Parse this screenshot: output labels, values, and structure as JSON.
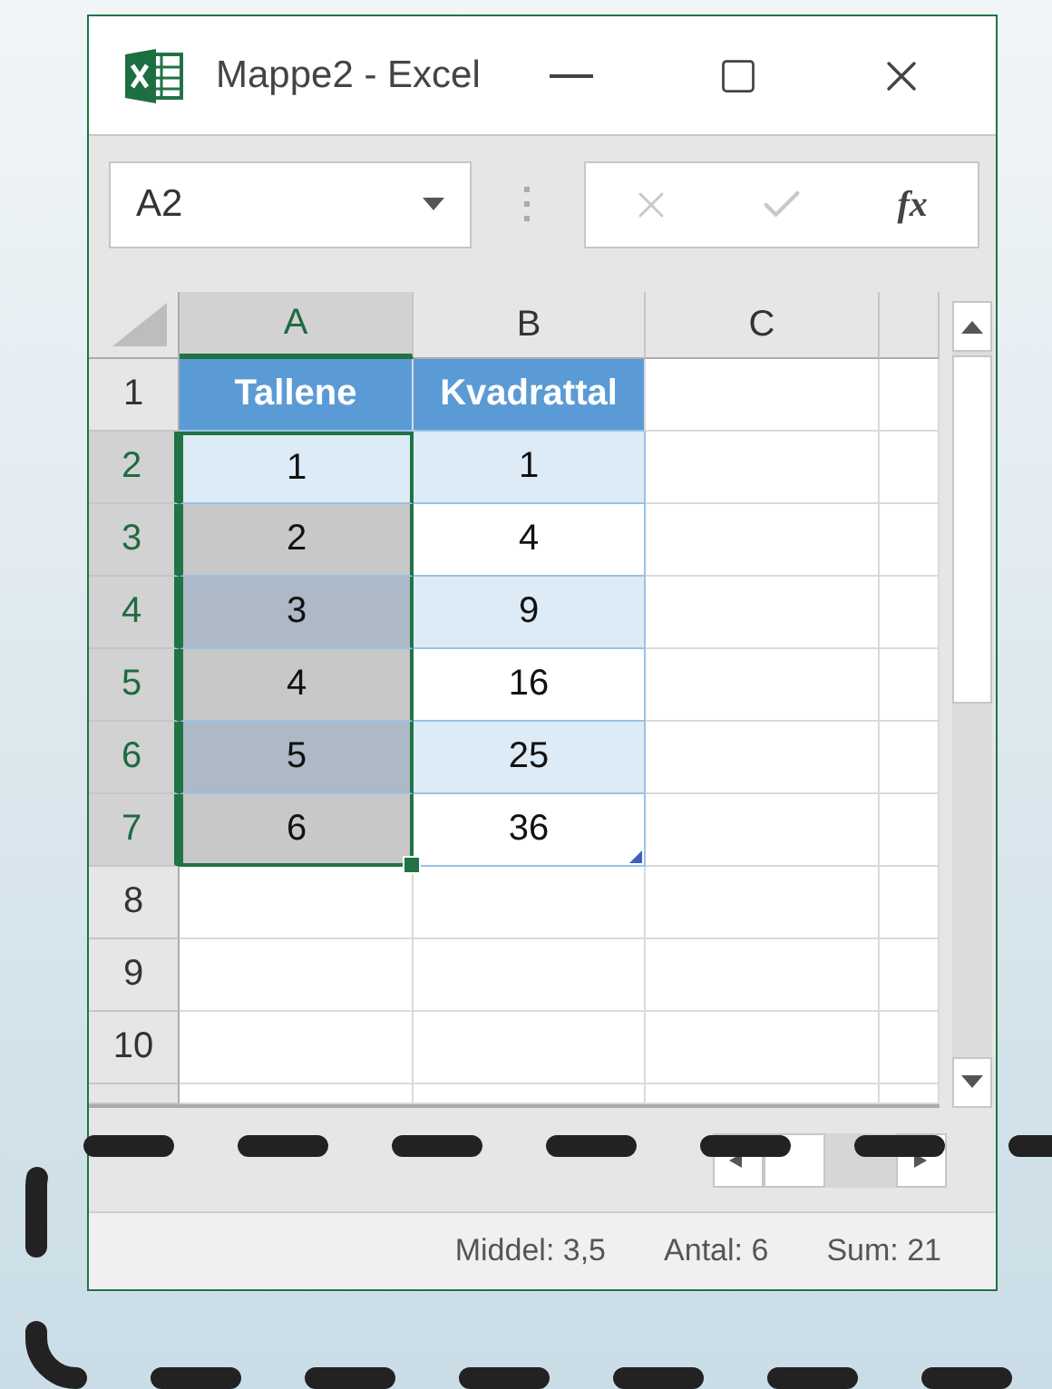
{
  "window": {
    "title": "Mappe2 - Excel"
  },
  "formula_bar": {
    "name_box": "A2",
    "function_button": "fx"
  },
  "sheet": {
    "columns": [
      {
        "label": "A",
        "selected": true
      },
      {
        "label": "B",
        "selected": false
      },
      {
        "label": "C",
        "selected": false
      }
    ],
    "rows": [
      {
        "header": "1",
        "selected": false,
        "cells": [
          {
            "value": "Tallene",
            "kind": "table-header",
            "selected": false
          },
          {
            "value": "Kvadrattal",
            "kind": "table-header",
            "selected": false
          }
        ]
      },
      {
        "header": "2",
        "selected": true,
        "cells": [
          {
            "value": "1",
            "kind": "table",
            "banded": true,
            "selected": true,
            "active": true
          },
          {
            "value": "1",
            "kind": "table",
            "banded": true,
            "selected": false
          }
        ]
      },
      {
        "header": "3",
        "selected": true,
        "cells": [
          {
            "value": "2",
            "kind": "table",
            "banded": false,
            "selected": true,
            "active": false
          },
          {
            "value": "4",
            "kind": "table",
            "banded": false,
            "selected": false
          }
        ]
      },
      {
        "header": "4",
        "selected": true,
        "cells": [
          {
            "value": "3",
            "kind": "table",
            "banded": true,
            "selected": true,
            "active": false
          },
          {
            "value": "9",
            "kind": "table",
            "banded": true,
            "selected": false
          }
        ]
      },
      {
        "header": "5",
        "selected": true,
        "cells": [
          {
            "value": "4",
            "kind": "table",
            "banded": false,
            "selected": true,
            "active": false
          },
          {
            "value": "16",
            "kind": "table",
            "banded": false,
            "selected": false
          }
        ]
      },
      {
        "header": "6",
        "selected": true,
        "cells": [
          {
            "value": "5",
            "kind": "table",
            "banded": true,
            "selected": true,
            "active": false
          },
          {
            "value": "25",
            "kind": "table",
            "banded": true,
            "selected": false
          }
        ]
      },
      {
        "header": "7",
        "selected": true,
        "cells": [
          {
            "value": "6",
            "kind": "table",
            "banded": false,
            "selected": true,
            "active": false
          },
          {
            "value": "36",
            "kind": "table",
            "banded": false,
            "selected": false
          }
        ]
      },
      {
        "header": "8",
        "selected": false
      },
      {
        "header": "9",
        "selected": false
      },
      {
        "header": "10",
        "selected": false
      }
    ]
  },
  "status_bar": [
    "Middel: 3,5",
    "Antal: 6",
    "Sum: 21"
  ]
}
